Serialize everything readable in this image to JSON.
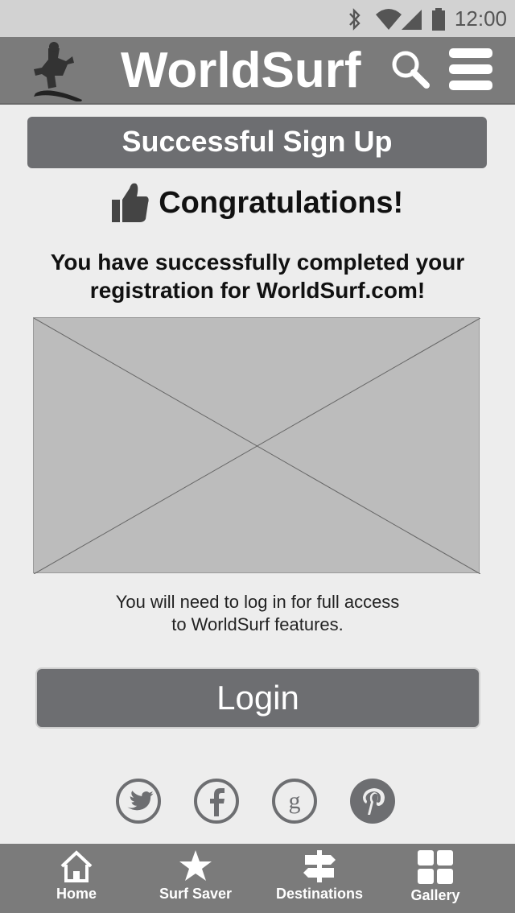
{
  "status_bar": {
    "time": "12:00",
    "icons": [
      "bluetooth-icon",
      "wifi-icon",
      "signal-icon",
      "battery-icon"
    ]
  },
  "app_bar": {
    "title": "WorldSurf",
    "logo_icon": "surfer-logo-icon",
    "search_icon": "search-icon",
    "menu_icon": "hamburger-menu-icon"
  },
  "banner": {
    "title": "Successful Sign Up"
  },
  "congrats": {
    "icon": "thumbs-up-icon",
    "text": "Congratulations!"
  },
  "message": {
    "line1": "You have successfully completed your",
    "line2": "registration for WorldSurf.com!"
  },
  "image_placeholder": {
    "icon": "image-placeholder"
  },
  "info": {
    "line1": "You will need to log in for full access",
    "line2": "to WorldSurf features."
  },
  "login_button": {
    "label": "Login"
  },
  "social": [
    "twitter-icon",
    "facebook-icon",
    "google-icon",
    "pinterest-icon"
  ],
  "bottom_nav": [
    {
      "label": "Home",
      "icon": "home-icon"
    },
    {
      "label": "Surf Saver",
      "icon": "star-icon"
    },
    {
      "label": "Destinations",
      "icon": "signpost-icon"
    },
    {
      "label": "Gallery",
      "icon": "grid-icon"
    }
  ],
  "colors": {
    "status_bar_bg": "#d2d2d2",
    "app_bar_bg": "#7b7b7b",
    "banner_bg": "#6d6e71",
    "page_bg": "#ededed",
    "placeholder_bg": "#bcbcbc"
  }
}
